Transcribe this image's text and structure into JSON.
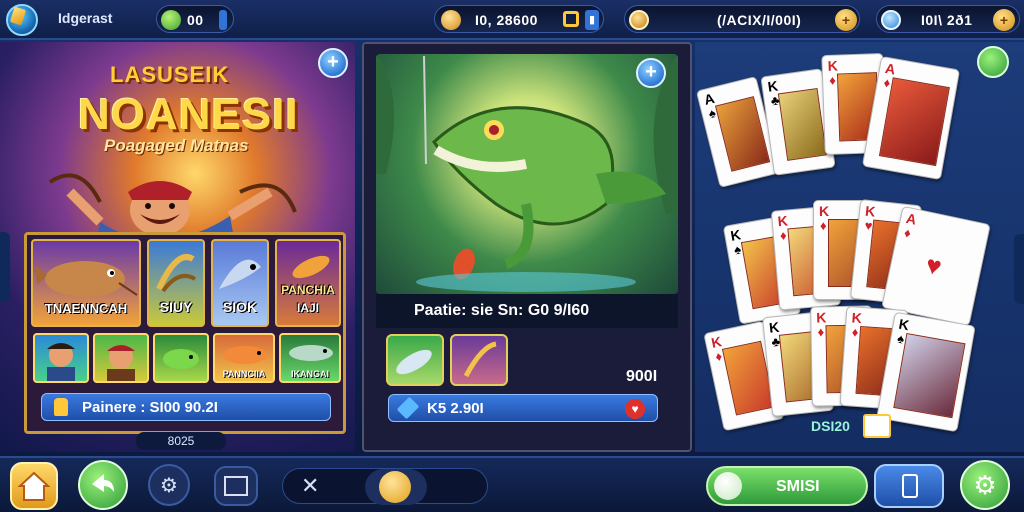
{
  "topbar": {
    "brand": "Idgerast",
    "counter_value": "00",
    "score_value": "I0, 28600",
    "coins_value": "(/ACIX/I/00I)",
    "gems_value": "I0I\\ 2ð1"
  },
  "left_panel": {
    "title_small": "LASUSEIK",
    "title_big": "NOANESII",
    "title_sub": "Poagaged Matnas",
    "tiles": [
      {
        "label": "TNAENNCAH"
      },
      {
        "label": "SIUY"
      },
      {
        "label": "SIOK"
      },
      {
        "label": "PANCHIA",
        "label2": "IAJI"
      }
    ],
    "mini_tiles": [
      {
        "label": ""
      },
      {
        "label": ""
      },
      {
        "label": ""
      },
      {
        "label": "PANNCIIA"
      },
      {
        "label": "IKANGAI"
      }
    ],
    "info_label": "Painere : SI00 90.2I",
    "footer_value": "8025"
  },
  "mid_panel": {
    "caption": "Paatie: sie Sn: G0 9/I60",
    "value_right": "900I",
    "info_label": "K5 2.90I"
  },
  "right_panel": {
    "cards_badge": "DSI20"
  },
  "bottombar": {
    "pill_label": "SMISI"
  },
  "colors": {
    "accent_gold": "#ffd84a",
    "info_blue": "#2a67c9",
    "success_green": "#3fc24a"
  }
}
